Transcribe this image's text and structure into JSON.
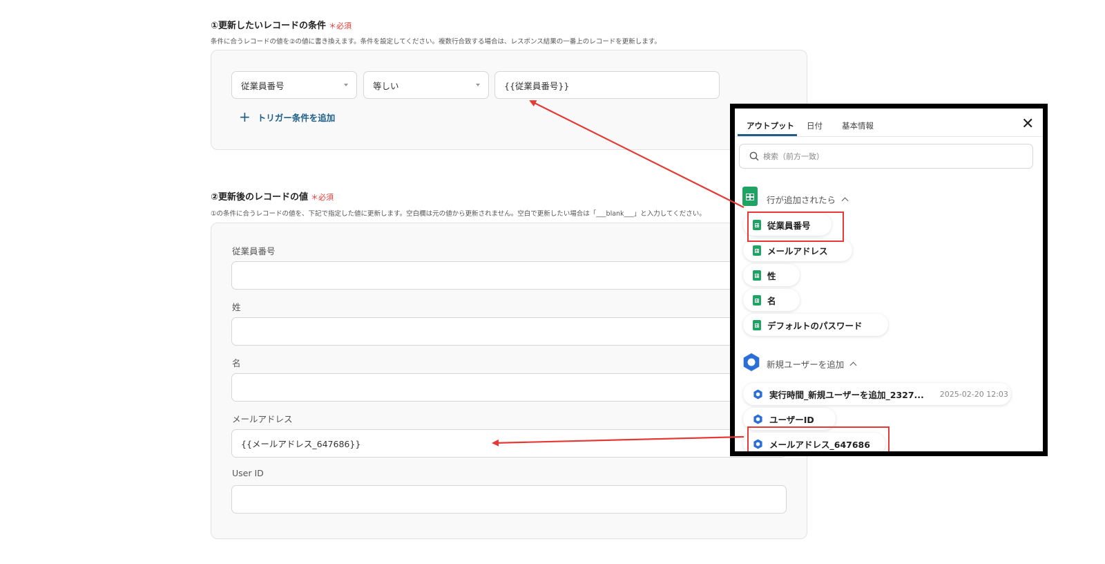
{
  "section1": {
    "title": "①更新したいレコードの条件",
    "required": "＊必須",
    "description": "条件に合うレコードの値を②の値に書き換えます。条件を設定してください。複数行合致する場合は、レスポンス結果の一番上のレコードを更新します。",
    "field_select": "従業員番号",
    "operator_select": "等しい",
    "value_input": "{{従業員番号}}",
    "add_trigger": "トリガー条件を追加"
  },
  "section2": {
    "title": "②更新後のレコードの値",
    "required": "＊必須",
    "description": "①の条件に合うレコードの値を、下記で指定した値に更新します。空白欄は元の値から更新されません。空白で更新したい場合は「___blank___」と入力してください。",
    "fields": [
      {
        "label": "従業員番号",
        "value": ""
      },
      {
        "label": "姓",
        "value": ""
      },
      {
        "label": "名",
        "value": ""
      },
      {
        "label": "メールアドレス",
        "value": "{{メールアドレス_647686}}"
      },
      {
        "label": "User ID",
        "value": ""
      }
    ]
  },
  "popup": {
    "tabs": [
      "アウトプット",
      "日付",
      "基本情報"
    ],
    "active_tab": "アウトプット",
    "search_placeholder": "検索（前方一致）",
    "group1": {
      "title": "行が追加されたら",
      "items": [
        "従業員番号",
        "メールアドレス",
        "性",
        "名",
        "デフォルトのパスワード"
      ]
    },
    "group2": {
      "title": "新規ユーザーを追加",
      "items": [
        {
          "label": "実行時間_新規ユーザーを追加_2327...",
          "timestamp": "2025-02-20 12:03"
        },
        {
          "label": "ユーザーID",
          "timestamp": ""
        },
        {
          "label": "メールアドレス_647686",
          "timestamp": ""
        }
      ]
    }
  },
  "colors": {
    "accent": "#1d5e8a",
    "required": "#e53935",
    "annotation": "#e53935",
    "sheets_green": "#1ea362",
    "workspace_blue": "#2b6fd6"
  }
}
